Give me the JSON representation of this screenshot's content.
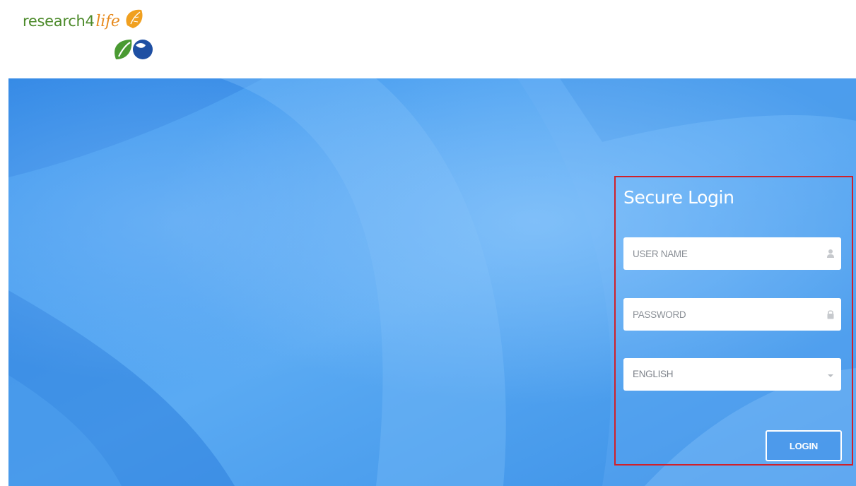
{
  "logo": {
    "word": "research4",
    "accent": "life",
    "brand_green": "#4c8a2a",
    "brand_orange": "#e78b1f",
    "brand_blue": "#1e4fa3"
  },
  "login": {
    "title": "Secure Login",
    "username": {
      "placeholder": "USER NAME",
      "value": "",
      "icon": "user-icon"
    },
    "password": {
      "placeholder": "PASSWORD",
      "value": "",
      "icon": "lock-icon"
    },
    "language": {
      "selected": "ENGLISH",
      "icon": "chevron-down-icon"
    },
    "button_label": "LOGIN",
    "highlight_color": "#d0202a"
  },
  "hero": {
    "background_color": "#4b9ff0"
  }
}
